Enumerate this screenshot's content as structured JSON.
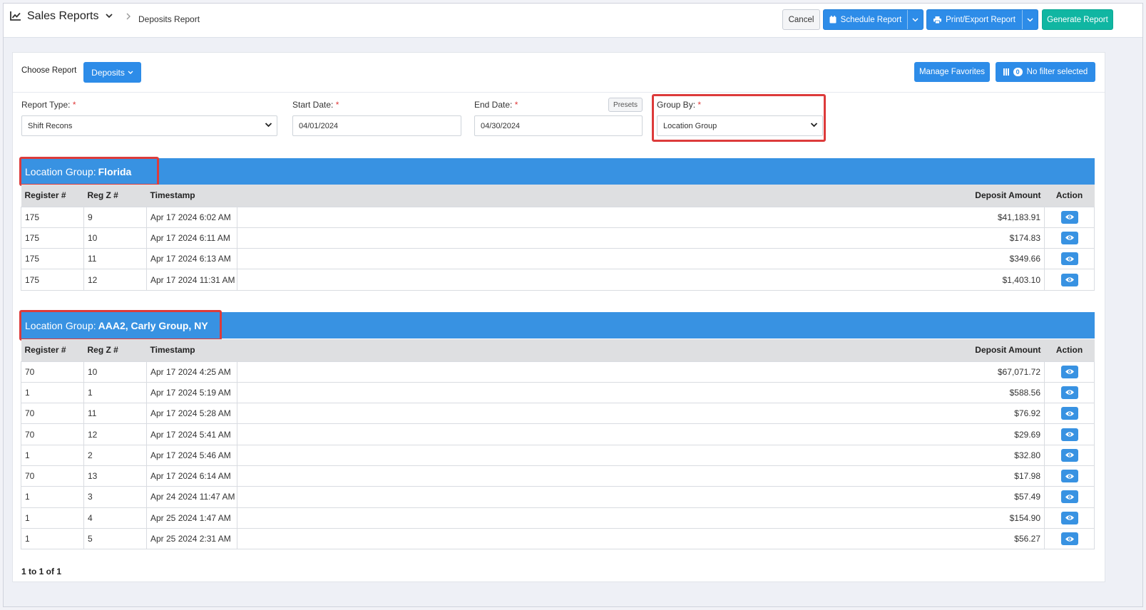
{
  "header": {
    "app_title": "Sales Reports",
    "breadcrumb": "Deposits Report",
    "buttons": {
      "cancel": "Cancel",
      "schedule": "Schedule Report",
      "print_export": "Print/Export Report",
      "generate": "Generate Report"
    }
  },
  "toolbar": {
    "choose_label": "Choose Report",
    "report_button": "Deposits",
    "manage_favorites": "Manage Favorites",
    "filter_count": "0",
    "filter_label": "No filter selected"
  },
  "form": {
    "report_type": {
      "label": "Report Type:",
      "required": "*",
      "value": "Shift Recons"
    },
    "start_date": {
      "label": "Start Date:",
      "required": "*",
      "value": "04/01/2024"
    },
    "end_date": {
      "label": "End Date:",
      "required": "*",
      "value": "04/30/2024"
    },
    "presets": "Presets",
    "group_by": {
      "label": "Group By:",
      "required": "*",
      "value": "Location Group"
    }
  },
  "table_columns": {
    "register": "Register #",
    "regz": "Reg Z #",
    "timestamp": "Timestamp",
    "amount": "Deposit Amount",
    "action": "Action"
  },
  "groups": [
    {
      "prefix": "Location Group:",
      "name": "Florida",
      "rows": [
        {
          "register": "175",
          "regz": "9",
          "timestamp": "Apr 17 2024 6:02 AM",
          "amount": "$41,183.91"
        },
        {
          "register": "175",
          "regz": "10",
          "timestamp": "Apr 17 2024 6:11 AM",
          "amount": "$174.83"
        },
        {
          "register": "175",
          "regz": "11",
          "timestamp": "Apr 17 2024 6:13 AM",
          "amount": "$349.66"
        },
        {
          "register": "175",
          "regz": "12",
          "timestamp": "Apr 17 2024 11:31 AM",
          "amount": "$1,403.10"
        }
      ]
    },
    {
      "prefix": "Location Group:",
      "name": "AAA2, Carly Group, NY",
      "rows": [
        {
          "register": "70",
          "regz": "10",
          "timestamp": "Apr 17 2024 4:25 AM",
          "amount": "$67,071.72"
        },
        {
          "register": "1",
          "regz": "1",
          "timestamp": "Apr 17 2024 5:19 AM",
          "amount": "$588.56"
        },
        {
          "register": "70",
          "regz": "11",
          "timestamp": "Apr 17 2024 5:28 AM",
          "amount": "$76.92"
        },
        {
          "register": "70",
          "regz": "12",
          "timestamp": "Apr 17 2024 5:41 AM",
          "amount": "$29.69"
        },
        {
          "register": "1",
          "regz": "2",
          "timestamp": "Apr 17 2024 5:46 AM",
          "amount": "$32.80"
        },
        {
          "register": "70",
          "regz": "13",
          "timestamp": "Apr 17 2024 6:14 AM",
          "amount": "$17.98"
        },
        {
          "register": "1",
          "regz": "3",
          "timestamp": "Apr 24 2024 11:47 AM",
          "amount": "$57.49"
        },
        {
          "register": "1",
          "regz": "4",
          "timestamp": "Apr 25 2024 1:47 AM",
          "amount": "$154.90"
        },
        {
          "register": "1",
          "regz": "5",
          "timestamp": "Apr 25 2024 2:31 AM",
          "amount": "$56.27"
        }
      ]
    }
  ],
  "pager": "1 to 1 of 1",
  "colors": {
    "primary": "#2d8ce8",
    "group_header": "#3892e2",
    "generate": "#10b6a2",
    "highlight": "#dd3b3b"
  },
  "icons": {
    "app": "chart-line-icon",
    "schedule": "calendar-icon",
    "print": "printer-icon",
    "filter": "filter-icon",
    "row_action": "eye-icon"
  }
}
